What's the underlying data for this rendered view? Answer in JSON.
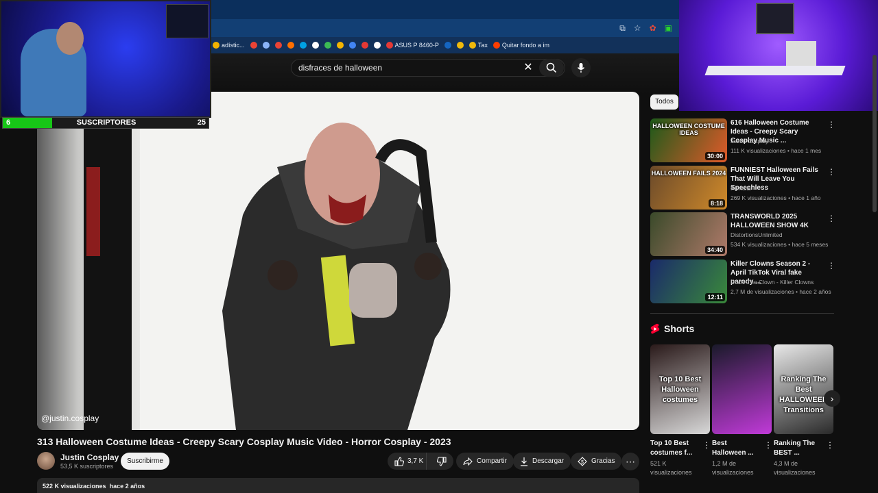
{
  "browser": {
    "bookmarks": [
      {
        "label": "adístic...",
        "color": "#f1b200"
      },
      {
        "label": "",
        "color": "#ea4335"
      },
      {
        "label": "",
        "color": "#8ab4f8"
      },
      {
        "label": "",
        "color": "#ea4335"
      },
      {
        "label": "",
        "color": "#ff6f00"
      },
      {
        "label": "",
        "color": "#00a1e4"
      },
      {
        "label": "",
        "color": "#ffffff"
      },
      {
        "label": "",
        "color": "#3cba54"
      },
      {
        "label": "",
        "color": "#f4b400"
      },
      {
        "label": "",
        "color": "#4285f4"
      },
      {
        "label": "",
        "color": "#e53935"
      },
      {
        "label": "",
        "color": "#ffffff"
      },
      {
        "label": "ASUS P 8460-P",
        "color": "#e53935"
      },
      {
        "label": "",
        "color": "#1565c0"
      },
      {
        "label": "",
        "color": "#f0b90b"
      },
      {
        "label": "Tax",
        "color": "#f0b90b"
      },
      {
        "label": "Quitar fondo a im",
        "color": "#ff3d00"
      }
    ]
  },
  "search": {
    "query": "disfraces de halloween"
  },
  "overlay": {
    "subscribers_current": "6",
    "subscribers_label": "SUSCRIPTORES",
    "subscribers_goal": "25",
    "progress": 0.24
  },
  "video": {
    "watermark": "@justin.cosplay",
    "title": "313 Halloween Costume Ideas - Creepy Scary Cosplay Music Video - Horror Cosplay - 2023",
    "channel": "Justin Cosplay",
    "subscribers": "53,5 K suscriptores",
    "subscribe_label": "Suscribirme",
    "likes": "3,7 K",
    "share_label": "Compartir",
    "download_label": "Descargar",
    "thanks_label": "Gracias",
    "views": "522 K visualizaciones",
    "age": "hace 2 años"
  },
  "sidebar": {
    "chip": "Todos",
    "recommendations": [
      {
        "title": "616 Halloween Costume Ideas - Creepy Scary Cosplay Music ...",
        "channel": "Justin Cosplay",
        "views": "111 K visualizaciones",
        "age": "hace 1 mes",
        "duration": "30:00",
        "thumb_text": "HALLOWEEN COSTUME IDEAS",
        "colors": [
          "#1d5a1a",
          "#e05a2a"
        ]
      },
      {
        "title": "FUNNIEST Halloween Fails That Will Leave You Speechless",
        "channel": "Funfails",
        "views": "269 K visualizaciones",
        "age": "hace 1 año",
        "duration": "8:18",
        "thumb_text": "HALLOWEEN FAILS 2024",
        "colors": [
          "#6b4a2a",
          "#d08a2a"
        ]
      },
      {
        "title": "TRANSWORLD 2025 HALLOWEEN SHOW 4K",
        "channel": "DistortionsUnlimited",
        "views": "534 K visualizaciones",
        "age": "hace 5 meses",
        "duration": "34:40",
        "thumb_text": "",
        "colors": [
          "#3a4a2a",
          "#b07a6a"
        ]
      },
      {
        "title": "Killer Clowns Season 2 - April TikTok Viral fake parody ...",
        "channel": "Uncle The Clown - Killer Clowns",
        "views": "2,7 M de visualizaciones",
        "age": "hace 2 años",
        "duration": "12:11",
        "thumb_text": "",
        "colors": [
          "#1a2a6a",
          "#3a8a3a"
        ]
      }
    ],
    "shorts_heading": "Shorts",
    "shorts": [
      {
        "title": "Top 10 Best costumes f...",
        "views": "521 K visualizaciones",
        "thumb_text": "Top 10 Best Halloween costumes",
        "colors": [
          "#2a1a1a",
          "#d8d8d8"
        ]
      },
      {
        "title": "Best Halloween ...",
        "views": "1,2 M de visualizaciones",
        "thumb_text": "",
        "colors": [
          "#1a1a2a",
          "#c03ad8"
        ]
      },
      {
        "title": "Ranking The BEST ...",
        "views": "4,3 M de visualizaciones",
        "thumb_text": "Ranking The Best HALLOWEEN Transitions",
        "colors": [
          "#e8e8e8",
          "#2a2a2a"
        ]
      }
    ]
  }
}
